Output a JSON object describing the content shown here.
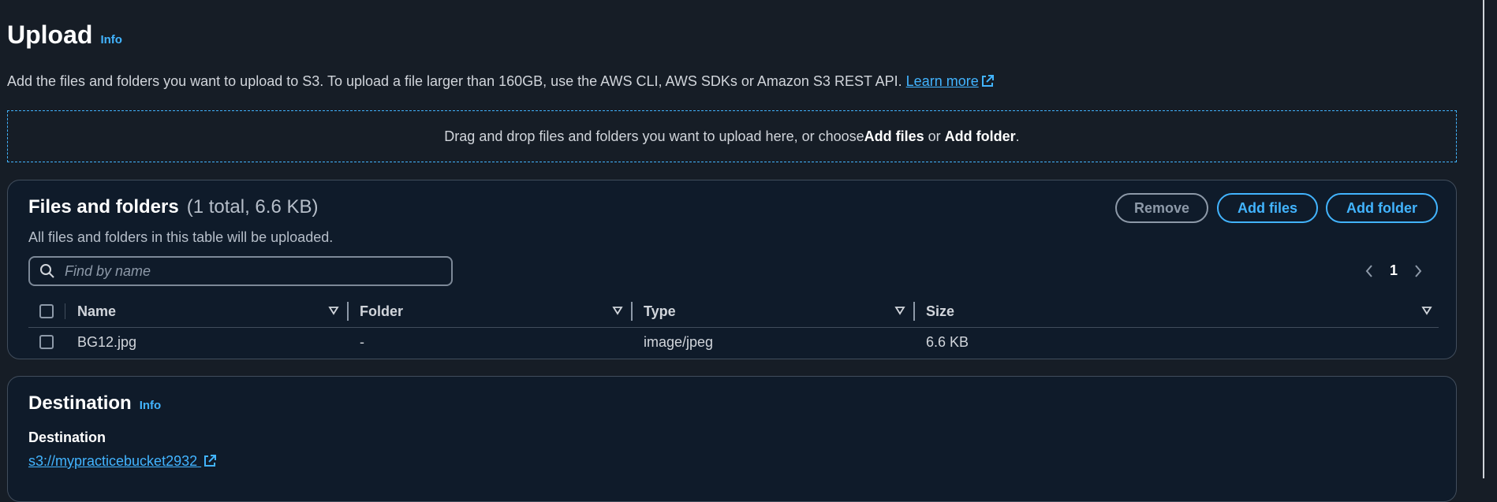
{
  "header": {
    "title": "Upload",
    "info": "Info",
    "description": "Add the files and folders you want to upload to S3. To upload a file larger than 160GB, use the AWS CLI, AWS SDKs or Amazon S3 REST API.",
    "learn_more": "Learn more"
  },
  "dropzone": {
    "text_prefix": "Drag and drop files and folders you want to upload here, or choose ",
    "add_files": "Add files",
    "or": " or ",
    "add_folder": "Add folder",
    "suffix": "."
  },
  "files_panel": {
    "title": "Files and folders",
    "count": "(1 total, 6.6 KB)",
    "subtitle": "All files and folders in this table will be uploaded.",
    "remove_label": "Remove",
    "add_files_label": "Add files",
    "add_folder_label": "Add folder",
    "search_placeholder": "Find by name",
    "page": "1",
    "columns": [
      "Name",
      "Folder",
      "Type",
      "Size"
    ],
    "rows": [
      {
        "name": "BG12.jpg",
        "folder": "-",
        "type": "image/jpeg",
        "size": "6.6 KB"
      }
    ]
  },
  "destination_panel": {
    "title": "Destination",
    "info": "Info",
    "label": "Destination",
    "link": "s3://mypracticebucket2932"
  },
  "colors": {
    "background": "#161d26",
    "panel": "#0f1b2a",
    "accent": "#42b4ff",
    "border": "#414d5c"
  }
}
